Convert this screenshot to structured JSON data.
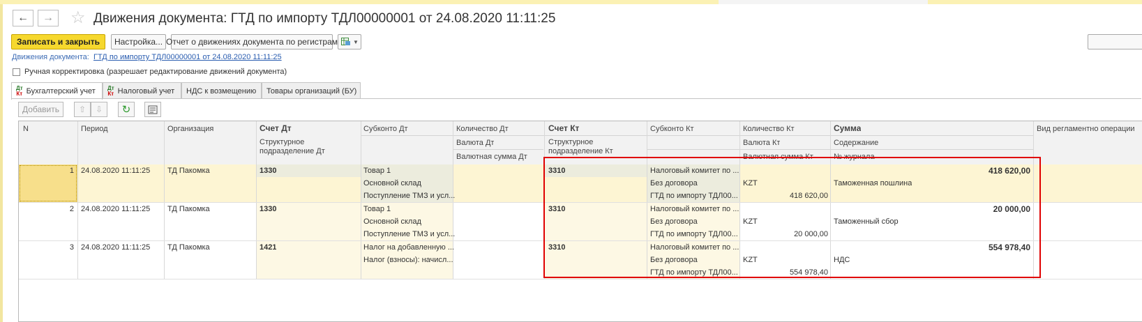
{
  "window": {
    "title": "Движения документа: ГТД по импорту ТДЛ00000001 от 24.08.2020 11:11:25",
    "back_icon": "arrow-left-icon",
    "forward_icon": "arrow-right-icon",
    "favorite_icon": "star-icon"
  },
  "toolbar": {
    "save_close": "Записать и закрыть",
    "settings": "Настройка...",
    "report": "Отчет о движениях документа по регистрам"
  },
  "breadcrumb": {
    "label": "Движения документа:",
    "link": "ГТД по импорту ТДЛ00000001 от 24.08.2020 11:11:25"
  },
  "manual_edit": {
    "label": "Ручная корректировка (разрешает редактирование движений документа)",
    "checked": false
  },
  "tabs": [
    {
      "label": "Бухгалтерский учет",
      "icon_top": "Дт",
      "icon_bottom": "Кт",
      "active": true
    },
    {
      "label": "Налоговый учет",
      "icon_top": "Дт",
      "icon_bottom": "Кт"
    },
    {
      "label": "НДС к возмещению"
    },
    {
      "label": "Товары организаций (БУ)"
    }
  ],
  "table_toolbar": {
    "add": "Добавить"
  },
  "grid": {
    "headers": {
      "n": "N",
      "period": "Период",
      "org": "Организация",
      "acc_dt": "Счет Дт",
      "acc_dt_sub": "Структурное подразделение Дт",
      "subconto_dt": "Субконто Дт",
      "qty_dt": "Количество Дт",
      "currency_dt": "Валюта Дт",
      "cursum_dt": "Валютная сумма Дт",
      "acc_kt": "Счет Кт",
      "acc_kt_sub": "Структурное подразделение Кт",
      "subconto_kt": "Субконто Кт",
      "qty_kt": "Количество Кт",
      "currency_kt": "Валюта Кт",
      "cursum_kt": "Валютная сумма Кт",
      "sum": "Сумма",
      "content": "Содержание",
      "journal": "№ журнала",
      "op_type": "Вид регламентно операции"
    },
    "rows": [
      {
        "n": "1",
        "period": "24.08.2020 11:11:25",
        "org": "ТД Пакомка",
        "acc_dt": "1330",
        "sub_dt": [
          "Товар 1",
          "Основной склад",
          "Поступление ТМЗ и усл..."
        ],
        "acc_kt": "3310",
        "sub_kt": [
          "Налоговый комитет по ...",
          "Без договора",
          "ГТД по импорту ТДЛ00..."
        ],
        "currency_kt": "KZT",
        "cursum_kt": "418 620,00",
        "sum": "418 620,00",
        "content": "Таможенная пошлина"
      },
      {
        "n": "2",
        "period": "24.08.2020 11:11:25",
        "org": "ТД Пакомка",
        "acc_dt": "1330",
        "sub_dt": [
          "Товар 1",
          "Основной склад",
          "Поступление ТМЗ и усл..."
        ],
        "acc_kt": "3310",
        "sub_kt": [
          "Налоговый комитет по ...",
          "Без договора",
          "ГТД по импорту ТДЛ00..."
        ],
        "currency_kt": "KZT",
        "cursum_kt": "20 000,00",
        "sum": "20 000,00",
        "content": "Таможенный сбор"
      },
      {
        "n": "3",
        "period": "24.08.2020 11:11:25",
        "org": "ТД Пакомка",
        "acc_dt": "1421",
        "sub_dt": [
          "Налог на добавленную ...",
          "Налог (взносы): начисл...",
          ""
        ],
        "acc_kt": "3310",
        "sub_kt": [
          "Налоговый комитет по ...",
          "Без договора",
          "ГТД по импорту ТДЛ00..."
        ],
        "currency_kt": "KZT",
        "cursum_kt": "554 978,40",
        "sum": "554 978,40",
        "content": "НДС"
      }
    ]
  },
  "colors": {
    "accent_yellow": "#f6d82e",
    "selected_row": "#fdf5d3",
    "highlight_box": "#e00000"
  }
}
